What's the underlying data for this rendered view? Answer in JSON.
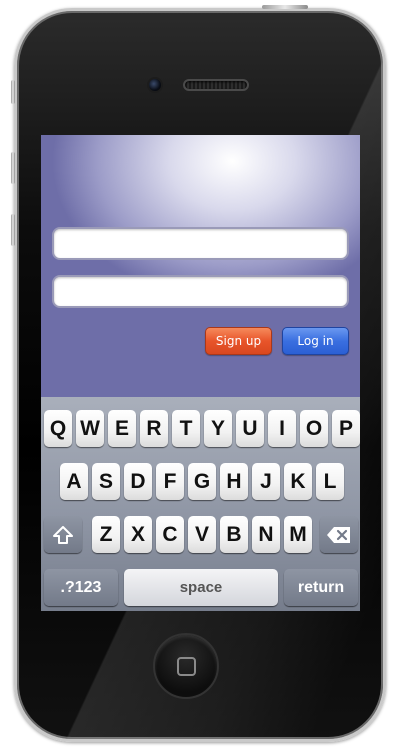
{
  "login": {
    "username_value": "",
    "password_value": "",
    "signup_label": "Sign up",
    "login_label": "Log in",
    "signup_color": "#e8552a",
    "login_color": "#3a6fe0"
  },
  "keyboard": {
    "row1": [
      "Q",
      "W",
      "E",
      "R",
      "T",
      "Y",
      "U",
      "I",
      "O",
      "P"
    ],
    "row2": [
      "A",
      "S",
      "D",
      "F",
      "G",
      "H",
      "J",
      "K",
      "L"
    ],
    "row3": [
      "Z",
      "X",
      "C",
      "V",
      "B",
      "N",
      "M"
    ],
    "shift_icon": "shift-arrow-icon",
    "delete_icon": "backspace-icon",
    "numbers_label": ".?123",
    "space_label": "space",
    "return_label": "return"
  },
  "device": {
    "home_icon": "home-square-icon"
  }
}
